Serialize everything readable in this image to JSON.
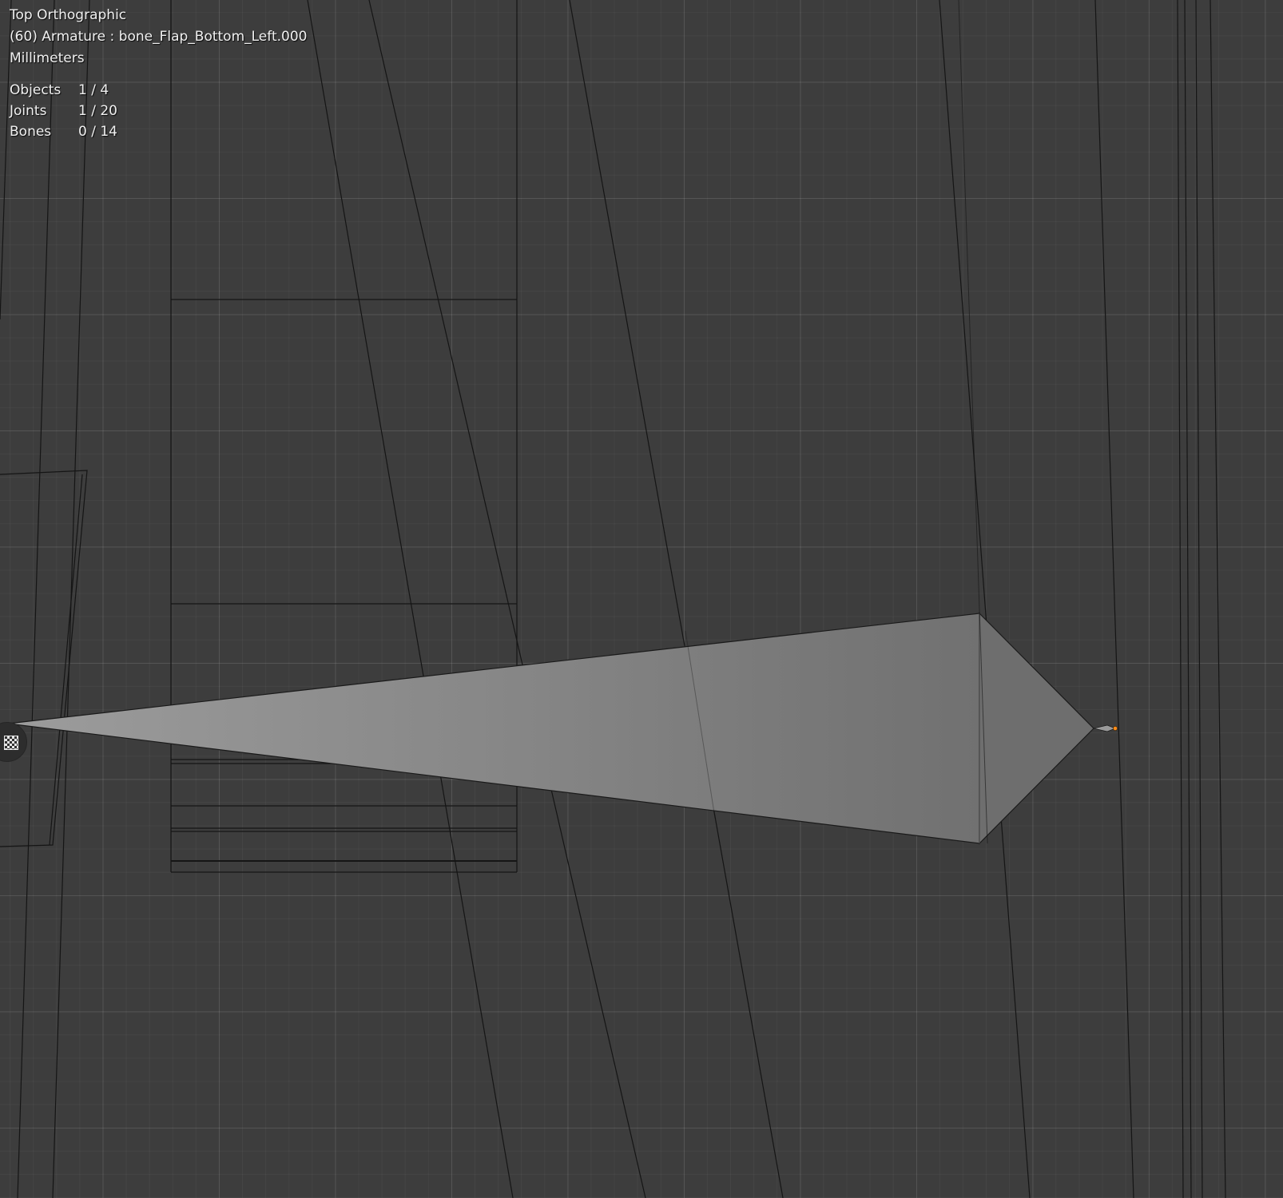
{
  "viewport": {
    "view_name": "Top Orthographic",
    "active_info": "(60) Armature : bone_Flap_Bottom_Left.000",
    "units": "Millimeters",
    "stats": [
      {
        "label": "Objects",
        "value": "1 / 4"
      },
      {
        "label": "Joints",
        "value": "1 / 20"
      },
      {
        "label": "Bones",
        "value": "0 / 14"
      }
    ]
  },
  "colors": {
    "background": "#3d3d3d",
    "bone_fill": "#8a8a8a",
    "wire": "#151515",
    "selected_joint": "#ff8c1a"
  },
  "icons": {
    "gizmo": "checker-gizmo-icon"
  }
}
